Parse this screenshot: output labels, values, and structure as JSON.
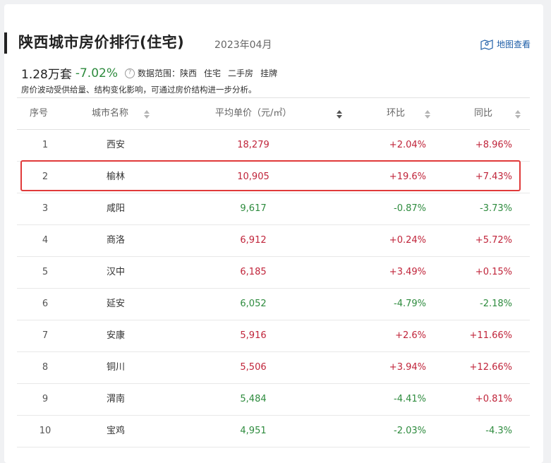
{
  "header": {
    "title": "陕西城市房价排行(住宅)",
    "date": "2023年04月",
    "map_link": "地图查看"
  },
  "summary": {
    "value": "1.28万套",
    "change": "-7.02%",
    "scope_label": "数据范围：",
    "scope_items": [
      "陕西",
      "住宅",
      "二手房",
      "挂牌"
    ],
    "note": "房价波动受供给量、结构变化影响，可通过房价结构进一步分析。"
  },
  "table": {
    "headers": {
      "index": "序号",
      "city": "城市名称",
      "price": "平均单价（元/㎡）",
      "mom": "环比",
      "yoy": "同比"
    },
    "rows": [
      {
        "index": "1",
        "city": "西安",
        "price": "18,279",
        "mom": "+2.04%",
        "yoy": "+8.96%"
      },
      {
        "index": "2",
        "city": "榆林",
        "price": "10,905",
        "mom": "+19.6%",
        "yoy": "+7.43%"
      },
      {
        "index": "3",
        "city": "咸阳",
        "price": "9,617",
        "mom": "-0.87%",
        "yoy": "-3.73%"
      },
      {
        "index": "4",
        "city": "商洛",
        "price": "6,912",
        "mom": "+0.24%",
        "yoy": "+5.72%"
      },
      {
        "index": "5",
        "city": "汉中",
        "price": "6,185",
        "mom": "+3.49%",
        "yoy": "+0.15%"
      },
      {
        "index": "6",
        "city": "延安",
        "price": "6,052",
        "mom": "-4.79%",
        "yoy": "-2.18%"
      },
      {
        "index": "7",
        "city": "安康",
        "price": "5,916",
        "mom": "+2.6%",
        "yoy": "+11.66%"
      },
      {
        "index": "8",
        "city": "铜川",
        "price": "5,506",
        "mom": "+3.94%",
        "yoy": "+12.66%"
      },
      {
        "index": "9",
        "city": "渭南",
        "price": "5,484",
        "mom": "-4.41%",
        "yoy": "+0.81%"
      },
      {
        "index": "10",
        "city": "宝鸡",
        "price": "4,951",
        "mom": "-2.03%",
        "yoy": "-4.3%"
      }
    ]
  },
  "colors": {
    "up": "#c0243a",
    "down": "#2e8b3e",
    "highlight": "#e03a3a",
    "link": "#1f5fa8"
  }
}
